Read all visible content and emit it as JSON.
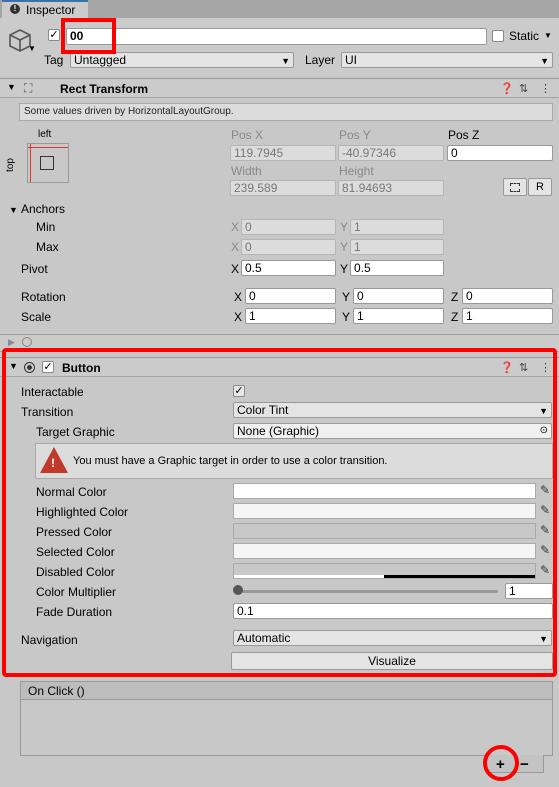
{
  "tab": {
    "title": "Inspector"
  },
  "object": {
    "name": "00",
    "static_label": "Static",
    "tag_label": "Tag",
    "tag_value": "Untagged",
    "layer_label": "Layer",
    "layer_value": "UI"
  },
  "rect": {
    "title": "Rect Transform",
    "notice": "Some values driven by HorizontalLayoutGroup.",
    "anchor_h": "left",
    "anchor_v": "top",
    "posx_label": "Pos X",
    "posy_label": "Pos Y",
    "posz_label": "Pos Z",
    "posx": "119.7945",
    "posy": "-40.97346",
    "posz": "0",
    "width_label": "Width",
    "height_label": "Height",
    "width": "239.589",
    "height": "81.94693",
    "r_button": "R",
    "anchors_label": "Anchors",
    "min_label": "Min",
    "max_label": "Max",
    "x": "X",
    "y": "Y",
    "z": "Z",
    "min_x": "0",
    "min_y": "1",
    "max_x": "0",
    "max_y": "1",
    "pivot_label": "Pivot",
    "pivot_x": "0.5",
    "pivot_y": "0.5",
    "rotation_label": "Rotation",
    "rot_x": "0",
    "rot_y": "0",
    "rot_z": "0",
    "scale_label": "Scale",
    "scale_x": "1",
    "scale_y": "1",
    "scale_z": "1"
  },
  "button": {
    "title": "Button",
    "interactable_label": "Interactable",
    "transition_label": "Transition",
    "transition_value": "Color Tint",
    "target_label": "Target Graphic",
    "target_value": "None (Graphic)",
    "warning": "You must have a Graphic target in order to use a color transition.",
    "normal_label": "Normal Color",
    "highlighted_label": "Highlighted Color",
    "pressed_label": "Pressed Color",
    "selected_label": "Selected Color",
    "disabled_label": "Disabled Color",
    "multiplier_label": "Color Multiplier",
    "multiplier_value": "1",
    "multiplier_fraction": 0.0,
    "fade_label": "Fade Duration",
    "fade_value": "0.1",
    "navigation_label": "Navigation",
    "navigation_value": "Automatic",
    "visualize": "Visualize",
    "onclick_title": "On Click ()",
    "plus": "+",
    "minus": "−"
  },
  "colors": {
    "highlight_red": "#ff0000",
    "panel": "#c8c8c8"
  }
}
